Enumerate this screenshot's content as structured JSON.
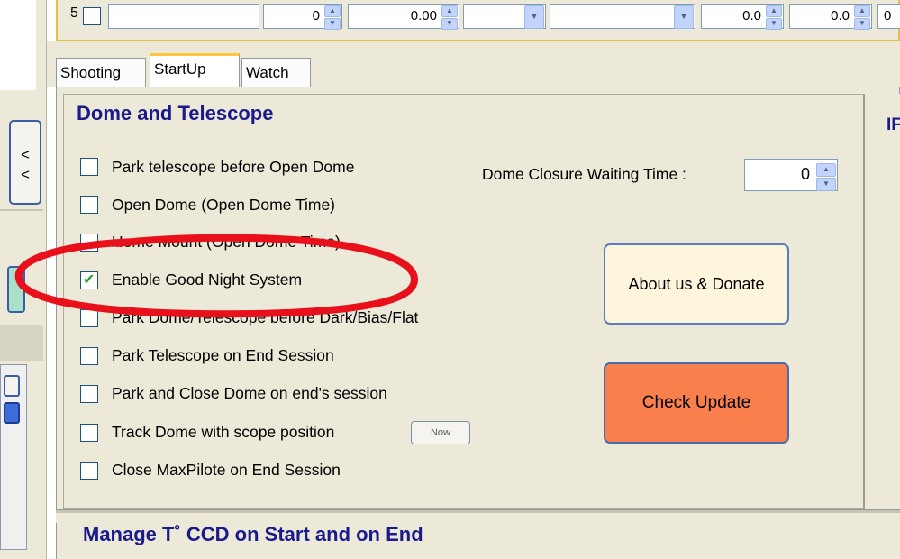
{
  "top_row": {
    "row_number": "5",
    "values": [
      "0",
      "0.00",
      "0.0",
      "0.0",
      "0"
    ]
  },
  "tabs": [
    "Shooting",
    "StartUp",
    "Watch"
  ],
  "group": {
    "title": "Dome and Telescope",
    "checkboxes": [
      {
        "label": "Park telescope before Open Dome",
        "checked": false
      },
      {
        "label": "Open Dome (Open Dome Time)",
        "checked": false
      },
      {
        "label": "Home Mount (Open Dome Time)",
        "checked": false
      },
      {
        "label": "Enable Good Night System",
        "checked": true
      },
      {
        "label": "Park Dome/Telescope before Dark/Bias/Flat",
        "checked": false
      },
      {
        "label": "Park Telescope on End Session",
        "checked": false
      },
      {
        "label": "Park and Close Dome on end's session",
        "checked": false
      },
      {
        "label": "Track Dome with scope position",
        "checked": false
      },
      {
        "label": "Close MaxPilote on End Session",
        "checked": false
      }
    ],
    "now_button": "Now",
    "dome_closure_label": "Dome Closure Waiting Time :",
    "dome_closure_value": "0",
    "about_button": "About us & Donate",
    "update_button": "Check Update"
  },
  "right_panel_text": "IF",
  "left_button_glyphs": [
    "<",
    "<"
  ],
  "bottom_title": "Manage T˚ CCD on Start and on End",
  "colors": {
    "title_blue": "#1a1a8c",
    "update_orange": "#f9804c",
    "about_cream": "#fdf5dc",
    "annotation_red": "#e8101a",
    "tab_highlight": "#ffc83c"
  },
  "icons": [
    "spin-up-icon",
    "spin-down-icon",
    "dropdown-arrow-icon",
    "check-icon"
  ]
}
